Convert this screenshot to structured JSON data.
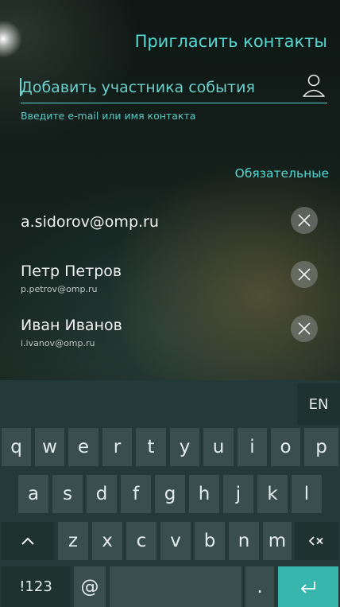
{
  "header": {
    "title": "Пригласить контакты"
  },
  "add_participant": {
    "placeholder": "Добавить участника события",
    "hint": "Введите e-mail или имя контакта"
  },
  "section": {
    "title": "Обязательные"
  },
  "contacts": [
    {
      "name": "a.sidorov@omp.ru",
      "email": ""
    },
    {
      "name": "Петр Петров",
      "email": "p.petrov@omp.ru"
    },
    {
      "name": "Иван  Иванов",
      "email": "i.ivanov@omp.ru"
    }
  ],
  "keyboard": {
    "language": "EN",
    "row1": [
      "q",
      "w",
      "e",
      "r",
      "t",
      "y",
      "u",
      "i",
      "o",
      "p"
    ],
    "row2": [
      "a",
      "s",
      "d",
      "f",
      "g",
      "h",
      "j",
      "k",
      "l"
    ],
    "row3": [
      "z",
      "x",
      "c",
      "v",
      "b",
      "n",
      "m"
    ],
    "symbols": "!123",
    "at": "@",
    "period": "."
  },
  "colors": {
    "accent": "#55d8d2",
    "keyboard_bg": "#243a38",
    "key_bg": "#3a4f4d",
    "enter_key": "#37b6ae"
  }
}
